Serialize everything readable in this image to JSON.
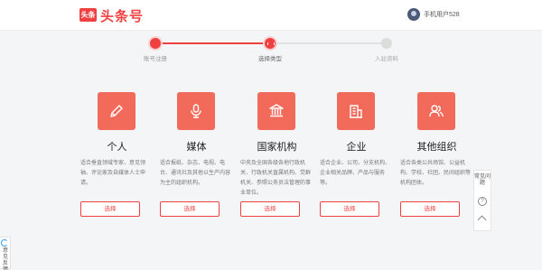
{
  "header": {
    "logo_badge": "头条",
    "logo_text": "头条号",
    "user_name": "手机用户528"
  },
  "steps": [
    {
      "label": "账号注册"
    },
    {
      "label": "选择类型"
    },
    {
      "label": "入驻资料"
    }
  ],
  "cards": [
    {
      "title": "个人",
      "description": "适合垂直领域专家、意见领袖、评论家及自媒体人士申请。",
      "button": "选择",
      "icon": "pencil-icon"
    },
    {
      "title": "媒体",
      "description": "适合报纸、杂志、电视、电台、通讯社及其他以生产内容为主的组织机构。",
      "button": "选择",
      "icon": "microphone-icon"
    },
    {
      "title": "国家机构",
      "description": "中央及全国各级各地行政机关、行政机关直属机构、党群机关、参照公务员法管理的事业单位。",
      "button": "选择",
      "icon": "government-building-icon"
    },
    {
      "title": "企业",
      "description": "适合企业、公司、分支机构、企业相关品牌、产品与服务等。",
      "button": "选择",
      "icon": "building-icon"
    },
    {
      "title": "其他组织",
      "description": "适合各类公共场馆、公益机构、学校、社团、民间组织等机构团体。",
      "button": "选择",
      "icon": "people-icon"
    }
  ],
  "side": {
    "label": "常见问题",
    "help": "?"
  },
  "feedback": {
    "label": "意见反馈"
  },
  "colors": {
    "accent": "#f04142",
    "icon_bg": "#f26a5a"
  }
}
